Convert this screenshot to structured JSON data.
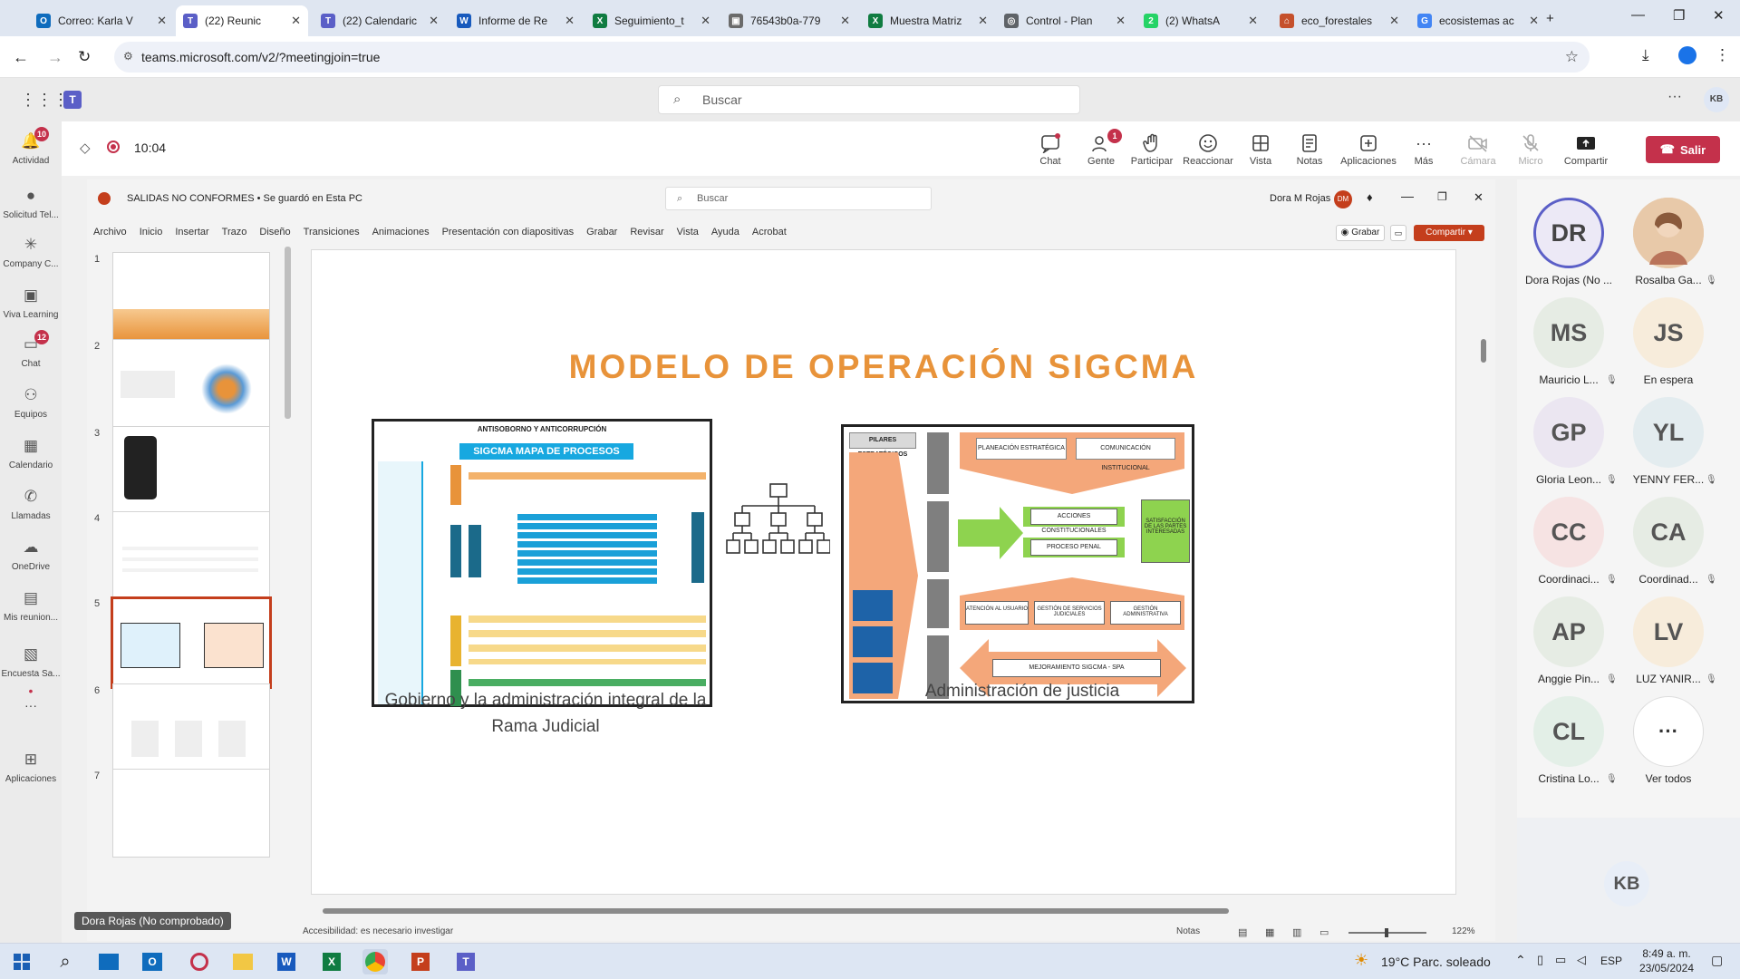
{
  "browser": {
    "tabs": [
      {
        "label": "Correo: Karla V",
        "color": "#0f6cbd",
        "glyph": "O",
        "icon": "outlook-icon"
      },
      {
        "label": "(22) Reunic",
        "color": "#5b5fc7",
        "glyph": "T",
        "icon": "teams-icon",
        "active": true
      },
      {
        "label": "(22) Calendaric",
        "color": "#5b5fc7",
        "glyph": "T",
        "icon": "teams-icon"
      },
      {
        "label": "Informe de Re",
        "color": "#185abd",
        "glyph": "W",
        "icon": "word-icon"
      },
      {
        "label": "Seguimiento_t",
        "color": "#107c41",
        "glyph": "X",
        "icon": "excel-icon"
      },
      {
        "label": "76543b0a-779",
        "color": "#6b6b6b",
        "glyph": "▣",
        "icon": "document-icon"
      },
      {
        "label": "Muestra Matriz",
        "color": "#107c41",
        "glyph": "X",
        "icon": "excel-icon"
      },
      {
        "label": "Control - Plan",
        "color": "#5f6368",
        "glyph": "◎",
        "icon": "globe-icon"
      },
      {
        "label": "(2) WhatsA",
        "color": "#25d366",
        "glyph": "2",
        "icon": "whatsapp-icon"
      },
      {
        "label": "eco_forestales",
        "color": "#c5502c",
        "glyph": "⌂",
        "icon": "folder-icon"
      },
      {
        "label": "ecosistemas ac",
        "color": "#4285f4",
        "glyph": "G",
        "icon": "google-icon"
      }
    ],
    "url": "teams.microsoft.com/v2/?meetingjoin=true"
  },
  "teams": {
    "search_placeholder": "Buscar",
    "user_initials": "KB",
    "rail": [
      {
        "label": "Actividad",
        "badge": "10"
      },
      {
        "label": "Solicitud Tel..."
      },
      {
        "label": "Company C..."
      },
      {
        "label": "Viva Learning"
      },
      {
        "label": "Chat",
        "badge": "12"
      },
      {
        "label": "Equipos"
      },
      {
        "label": "Calendario"
      },
      {
        "label": "Llamadas"
      },
      {
        "label": "OneDrive"
      },
      {
        "label": "Mis reunion..."
      },
      {
        "label": "Encuesta Sa..."
      },
      {
        "label": "Aplicaciones"
      }
    ],
    "meeting": {
      "time": "10:04",
      "buttons": {
        "chat": "Chat",
        "people": "Gente",
        "people_badge": "1",
        "raise": "Participar",
        "react": "Reaccionar",
        "view": "Vista",
        "notes": "Notas",
        "apps": "Aplicaciones",
        "more": "Más",
        "camera": "Cámara",
        "mic": "Micro",
        "share": "Compartir",
        "leave": "Salir"
      }
    },
    "participants": [
      {
        "initials": "DR",
        "name": "Dora Rojas (No ...",
        "color": "#ece9f6",
        "text": "#444",
        "ring": "#5b5fc7"
      },
      {
        "initials": "",
        "name": "Rosalba Ga...",
        "color": "#e8c9a9",
        "photo": true
      },
      {
        "initials": "MS",
        "name": "Mauricio L...",
        "color": "#e6ece4",
        "text": "#555"
      },
      {
        "initials": "JS",
        "name": "En espera",
        "color": "#f7ecdb",
        "text": "#555"
      },
      {
        "initials": "GP",
        "name": "Gloria Leon...",
        "color": "#ebe6f1",
        "text": "#555"
      },
      {
        "initials": "YL",
        "name": "YENNY FER...",
        "color": "#e3ecef",
        "text": "#555"
      },
      {
        "initials": "CC",
        "name": "Coordinaci...",
        "color": "#f6e3e3",
        "text": "#555"
      },
      {
        "initials": "CA",
        "name": "Coordinad...",
        "color": "#e6ece4",
        "text": "#555"
      },
      {
        "initials": "AP",
        "name": "Anggie Pin...",
        "color": "#e6ece4",
        "text": "#555"
      },
      {
        "initials": "LV",
        "name": "LUZ YANIR...",
        "color": "#f7ecdb",
        "text": "#555"
      },
      {
        "initials": "CL",
        "name": "Cristina Lo...",
        "color": "#e3efe7",
        "text": "#555"
      },
      {
        "initials": "···",
        "name": "Ver todos",
        "color": "#ffffff",
        "text": "#333"
      }
    ],
    "self_initials": "KB",
    "presenter_label": "Dora Rojas (No comprobado)"
  },
  "ppt": {
    "title": "SALIDAS NO CONFORMES • Se guardó en Esta PC",
    "search_placeholder": "Buscar",
    "user": "Dora M Rojas",
    "user_initials": "DM",
    "menu": [
      "Archivo",
      "Inicio",
      "Insertar",
      "Trazo",
      "Diseño",
      "Transiciones",
      "Animaciones",
      "Presentación con diapositivas",
      "Grabar",
      "Revisar",
      "Vista",
      "Ayuda",
      "Acrobat"
    ],
    "record": "Grabar",
    "share": "Compartir",
    "thumb_numbers": [
      "1",
      "2",
      "3",
      "4",
      "5",
      "6",
      "7"
    ],
    "slide": {
      "title": "MODELO DE OPERACIÓN SIGCMA",
      "left_caption": "Gobierno y la administración integral de la Rama Judicial",
      "right_caption": "Administración de justicia",
      "left_header": "ANTISOBORNO Y ANTICORRUPCIÓN",
      "left_banner": "SIGCMA MAPA DE PROCESOS",
      "right_pillars": "PILARES ESTRATÉGICOS",
      "right_top_1": "PLANEACIÓN ESTRATÉGICA",
      "right_top_2": "COMUNICACIÓN INSTITUCIONAL",
      "right_mid_1": "ACCIONES CONSTITUCIONALES",
      "right_mid_2": "PROCESO PENAL",
      "right_low_1": "ATENCIÓN AL USUARIO",
      "right_low_2": "GESTIÓN DE SERVICIOS JUDICIALES",
      "right_low_3": "GESTIÓN ADMINISTRATIVA",
      "right_improve": "MEJORAMIENTO SIGCMA - SPA",
      "right_satisf": "SATISFACCIÓN DE LAS PARTES INTERESADAS"
    },
    "status_left": "Accesibilidad: es necesario investigar",
    "status_notes": "Notas",
    "zoom": "122%"
  },
  "taskbar": {
    "weather": "19°C  Parc. soleado",
    "lang": "ESP",
    "time": "8:49 a. m.",
    "date": "23/05/2024"
  }
}
